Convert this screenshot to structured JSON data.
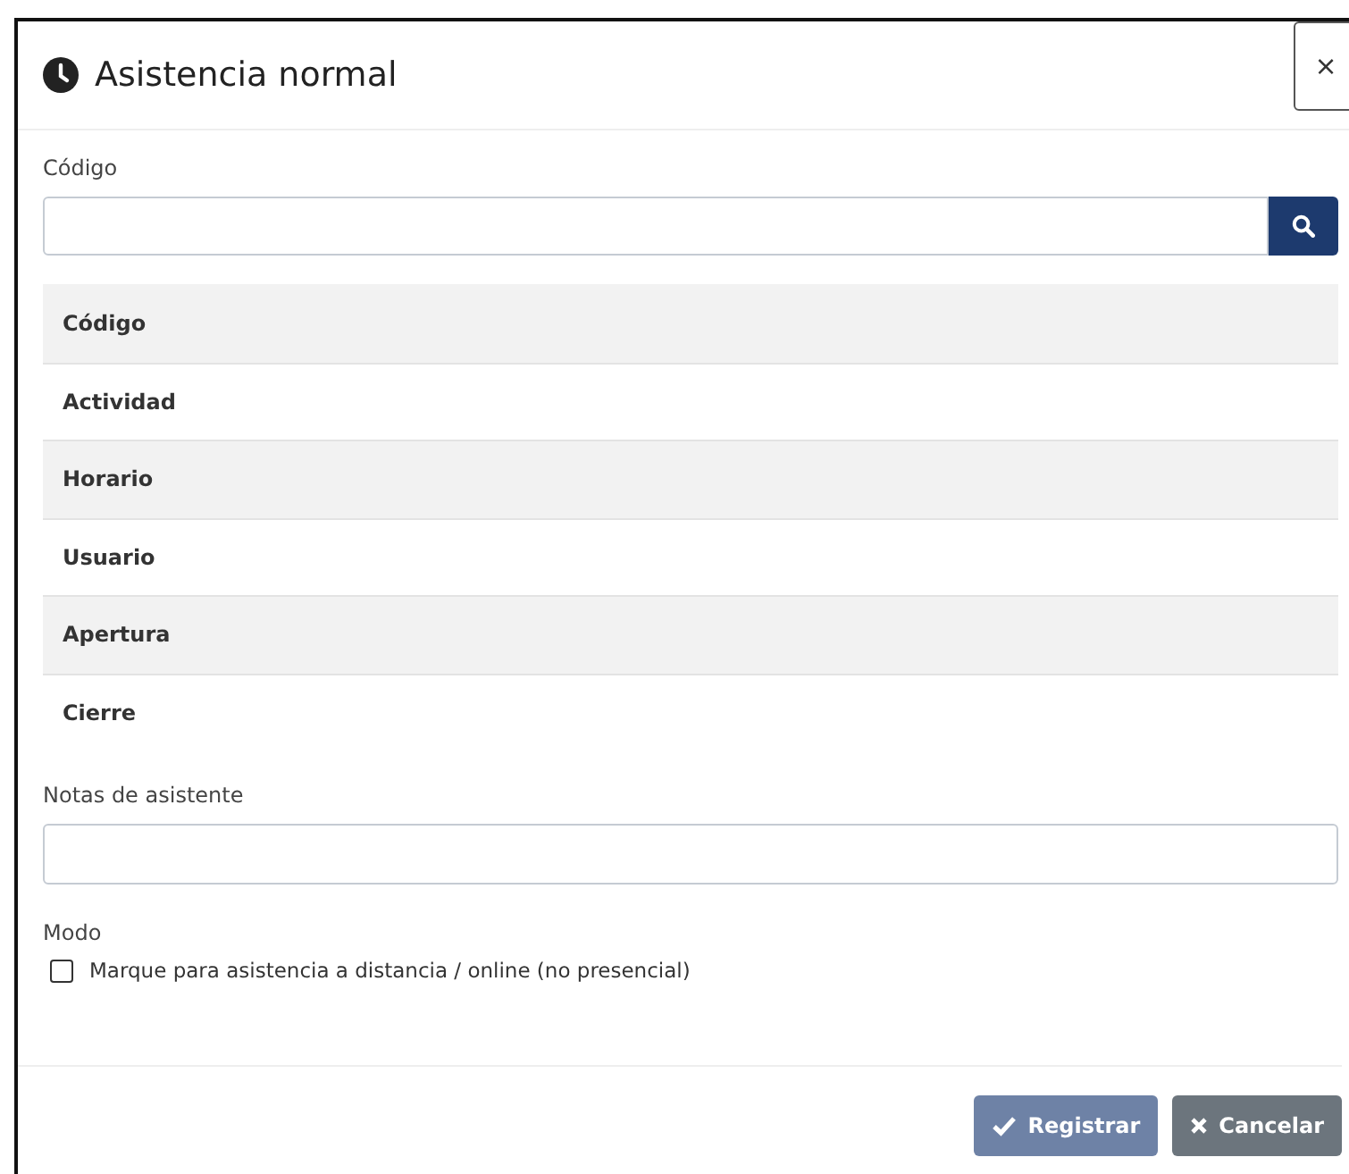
{
  "dialog": {
    "title": "Asistencia normal",
    "close": "×"
  },
  "code_field": {
    "label": "Código"
  },
  "details": [
    {
      "label": "Código"
    },
    {
      "label": "Actividad"
    },
    {
      "label": "Horario"
    },
    {
      "label": "Usuario"
    },
    {
      "label": "Apertura"
    },
    {
      "label": "Cierre"
    }
  ],
  "notes_field": {
    "label": "Notas de asistente"
  },
  "mode": {
    "label": "Modo",
    "option": {
      "label": "Marque para asistencia a distancia / online (no presencial)",
      "checked": false
    }
  },
  "buttons": [
    {
      "kind": "primary",
      "label": "Registrar",
      "disabled": true
    },
    {
      "kind": "cancel",
      "label": "Cancelar",
      "disabled": false
    }
  ]
}
